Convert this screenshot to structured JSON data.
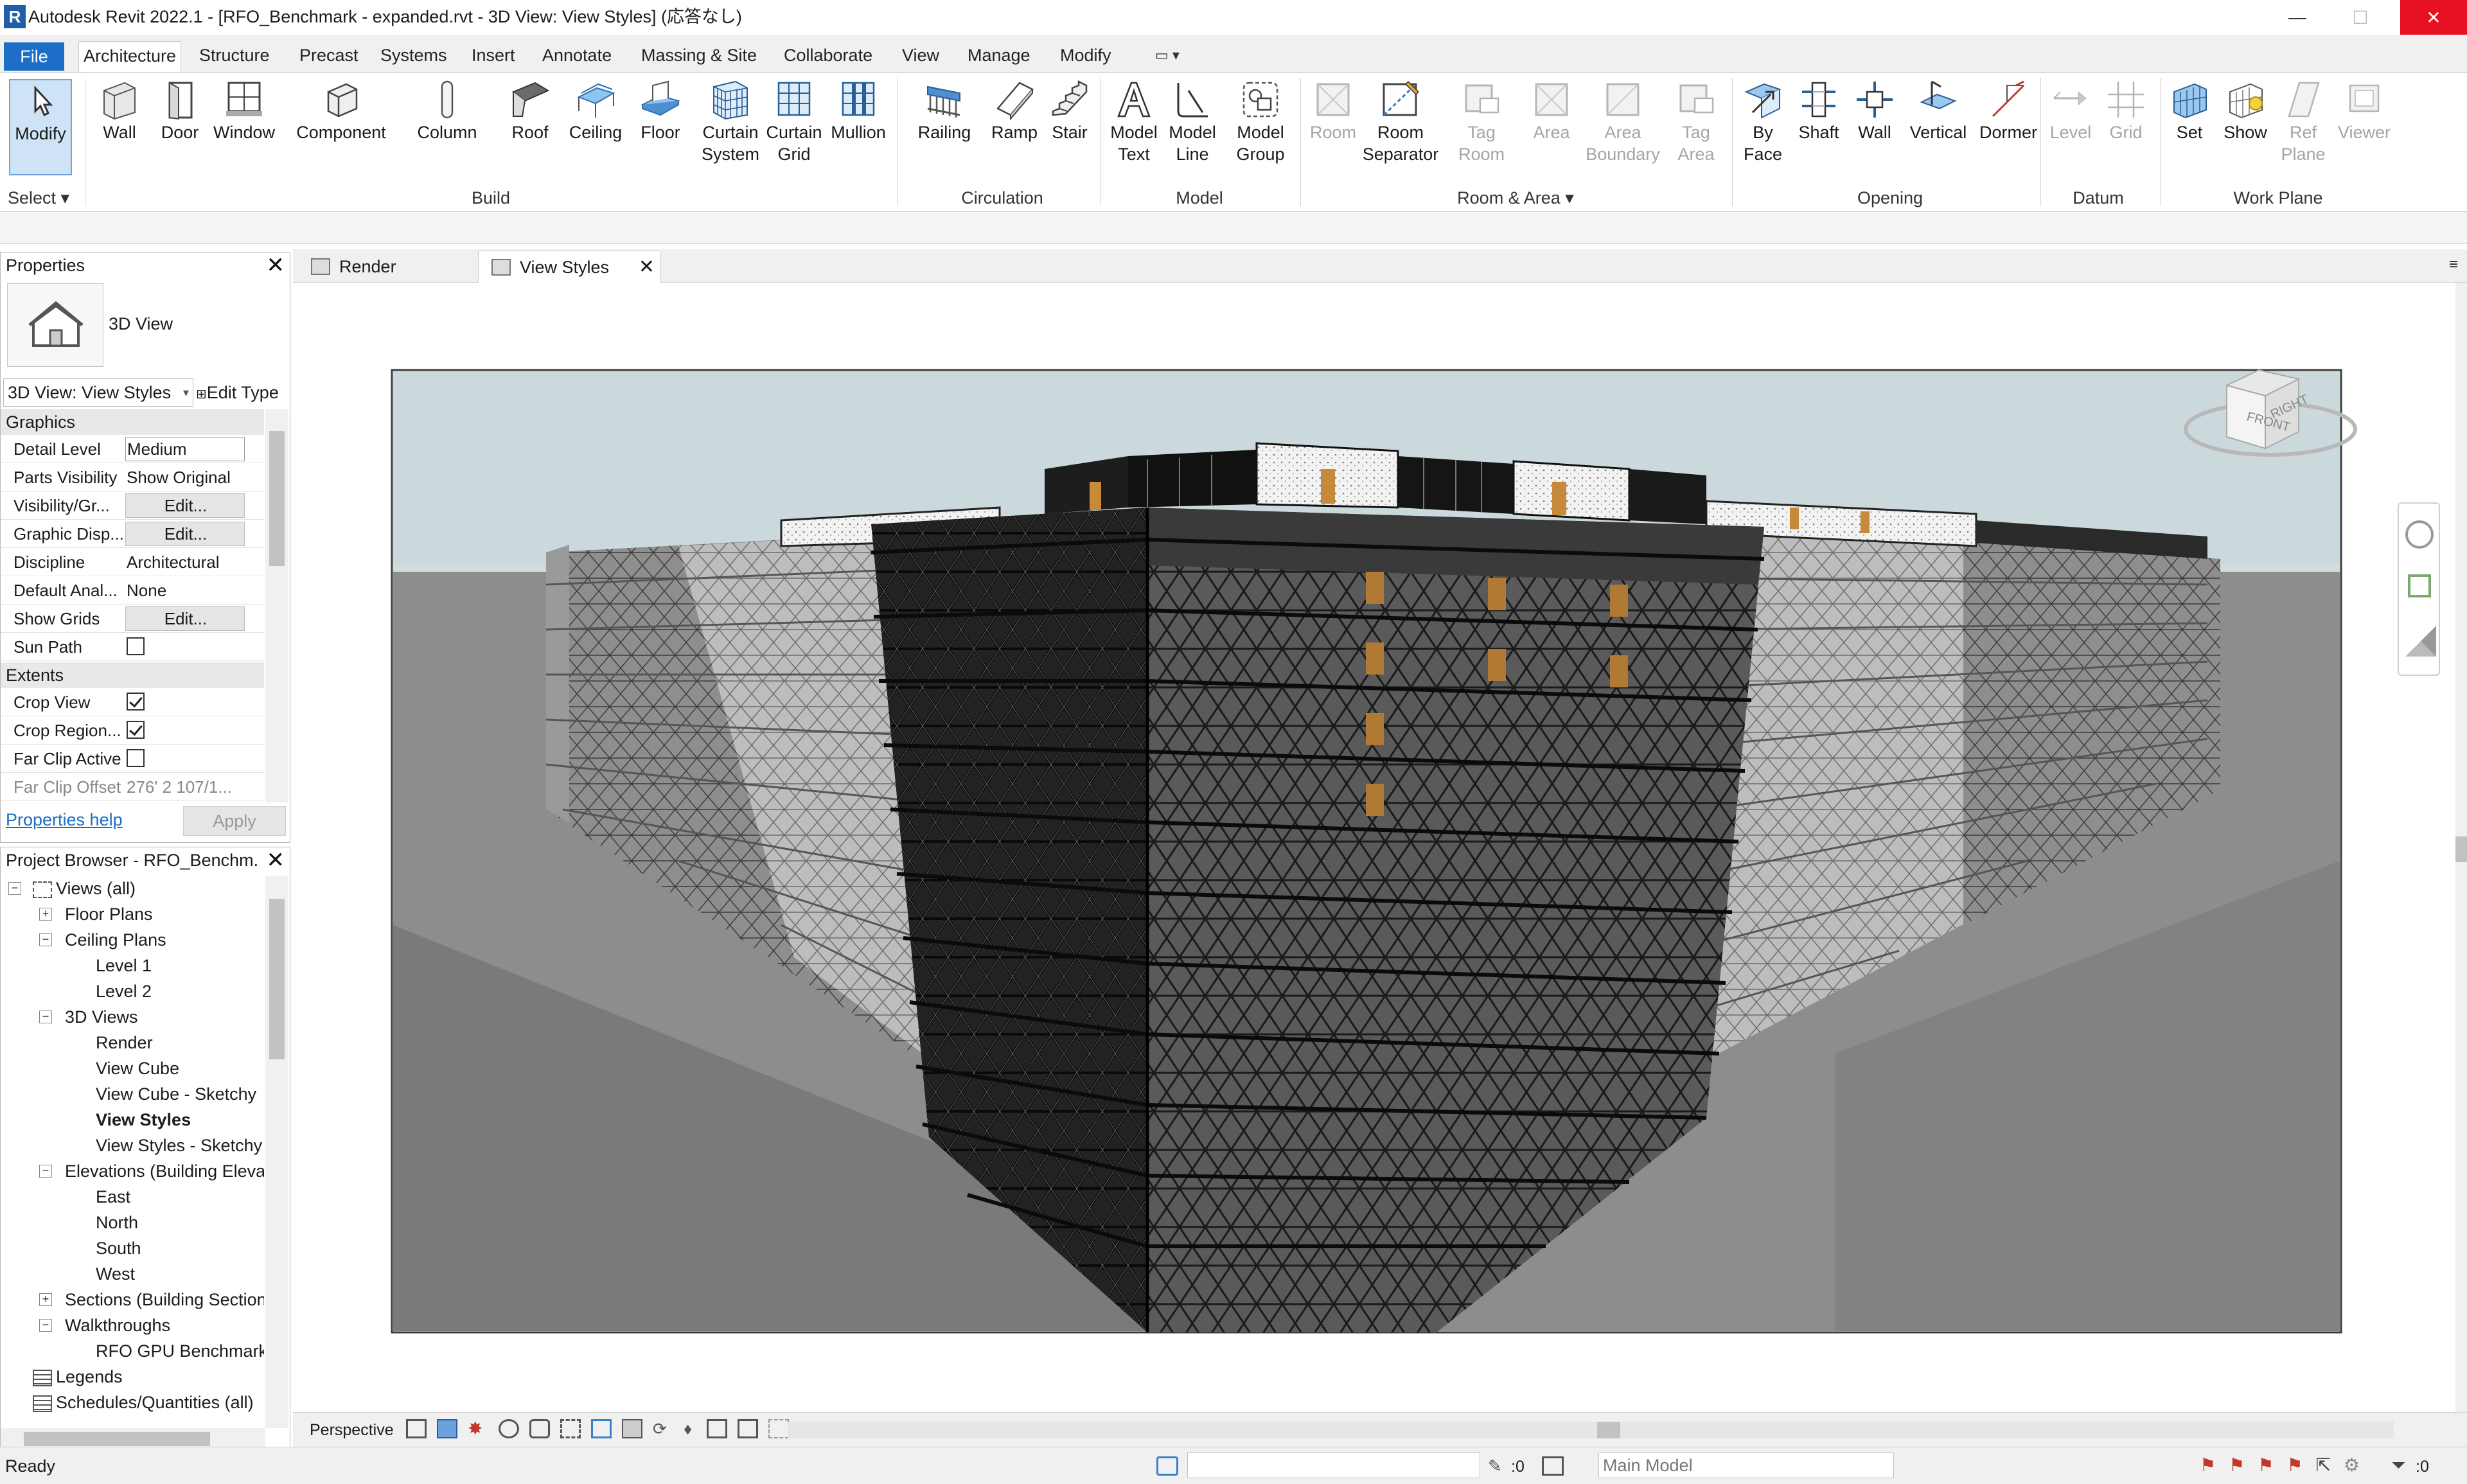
{
  "window": {
    "title": "Autodesk Revit 2022.1 - [RFO_Benchmark - expanded.rvt - 3D View: View Styles] (応答なし)",
    "app_icon_letter": "R",
    "minimize": "—",
    "maximize": "☐",
    "close": "✕"
  },
  "menu": {
    "tabs": [
      "File",
      "Architecture",
      "Structure",
      "Precast",
      "Systems",
      "Insert",
      "Annotate",
      "Massing & Site",
      "Collaborate",
      "View",
      "Manage",
      "Modify"
    ],
    "active": "Architecture",
    "quick_access": "▭ ▾"
  },
  "ribbon": {
    "groups": [
      {
        "label": "Select ▾",
        "buttons": [
          {
            "label": "Modify",
            "icon": "cursor-icon",
            "enabled": true
          }
        ]
      },
      {
        "label": "Build",
        "buttons": [
          {
            "label": "Wall",
            "icon": "wall-icon",
            "enabled": true,
            "dropdown": true
          },
          {
            "label": "Door",
            "icon": "door-icon",
            "enabled": true
          },
          {
            "label": "Window",
            "icon": "window-icon",
            "enabled": true
          },
          {
            "label": "Component",
            "icon": "component-icon",
            "enabled": true,
            "dropdown": true
          },
          {
            "label": "Column",
            "icon": "column-icon",
            "enabled": true,
            "dropdown": true
          },
          {
            "label": "Roof",
            "icon": "roof-icon",
            "enabled": true,
            "dropdown": true
          },
          {
            "label": "Ceiling",
            "icon": "ceiling-icon",
            "enabled": true
          },
          {
            "label": "Floor",
            "icon": "floor-icon",
            "enabled": true,
            "dropdown": true
          },
          {
            "label": "Curtain\nSystem",
            "icon": "curtain-system-icon",
            "enabled": true
          },
          {
            "label": "Curtain\nGrid",
            "icon": "curtain-grid-icon",
            "enabled": true
          },
          {
            "label": "Mullion",
            "icon": "mullion-icon",
            "enabled": true
          }
        ]
      },
      {
        "label": "Circulation",
        "buttons": [
          {
            "label": "Railing",
            "icon": "railing-icon",
            "enabled": true,
            "dropdown": true
          },
          {
            "label": "Ramp",
            "icon": "ramp-icon",
            "enabled": true
          },
          {
            "label": "Stair",
            "icon": "stair-icon",
            "enabled": true
          }
        ]
      },
      {
        "label": "Model",
        "buttons": [
          {
            "label": "Model\nText",
            "icon": "model-text-icon",
            "enabled": true
          },
          {
            "label": "Model\nLine",
            "icon": "model-line-icon",
            "enabled": true
          },
          {
            "label": "Model\nGroup",
            "icon": "model-group-icon",
            "enabled": true,
            "dropdown": true
          }
        ]
      },
      {
        "label": "Room & Area ▾",
        "buttons": [
          {
            "label": "Room",
            "icon": "room-icon",
            "enabled": false
          },
          {
            "label": "Room\nSeparator",
            "icon": "room-separator-icon",
            "enabled": true
          },
          {
            "label": "Tag\nRoom",
            "icon": "tag-room-icon",
            "enabled": false,
            "dropdown": true
          },
          {
            "label": "Area",
            "icon": "area-icon",
            "enabled": false,
            "dropdown": true
          },
          {
            "label": "Area\nBoundary",
            "icon": "area-boundary-icon",
            "enabled": false
          },
          {
            "label": "Tag\nArea",
            "icon": "tag-area-icon",
            "enabled": false,
            "dropdown": true
          }
        ]
      },
      {
        "label": "Opening",
        "buttons": [
          {
            "label": "By\nFace",
            "icon": "by-face-icon",
            "enabled": true
          },
          {
            "label": "Shaft",
            "icon": "shaft-icon",
            "enabled": true
          },
          {
            "label": "Wall",
            "icon": "wall-opening-icon",
            "enabled": true
          },
          {
            "label": "Vertical",
            "icon": "vertical-opening-icon",
            "enabled": true
          },
          {
            "label": "Dormer",
            "icon": "dormer-icon",
            "enabled": true
          }
        ]
      },
      {
        "label": "Datum",
        "buttons": [
          {
            "label": "Level",
            "icon": "level-icon",
            "enabled": false
          },
          {
            "label": "Grid",
            "icon": "grid-icon",
            "enabled": false
          }
        ]
      },
      {
        "label": "Work Plane",
        "buttons": [
          {
            "label": "Set",
            "icon": "set-workplane-icon",
            "enabled": true
          },
          {
            "label": "Show",
            "icon": "show-workplane-icon",
            "enabled": true
          },
          {
            "label": "Ref\nPlane",
            "icon": "ref-plane-icon",
            "enabled": false
          },
          {
            "label": "Viewer",
            "icon": "viewer-icon",
            "enabled": false
          }
        ]
      }
    ]
  },
  "properties": {
    "title": "Properties",
    "type_name": "3D View",
    "instance_selector": "3D View: View Styles",
    "edit_type": "Edit Type",
    "category_graphics": "Graphics",
    "category_extents": "Extents",
    "rows": [
      {
        "key": "Detail Level",
        "value": "Medium",
        "kind": "box"
      },
      {
        "key": "Parts Visibility",
        "value": "Show Original",
        "kind": "text"
      },
      {
        "key": "Visibility/Gr...",
        "value": "Edit...",
        "kind": "btn"
      },
      {
        "key": "Graphic Disp...",
        "value": "Edit...",
        "kind": "btn"
      },
      {
        "key": "Discipline",
        "value": "Architectural",
        "kind": "text"
      },
      {
        "key": "Default Anal...",
        "value": "None",
        "kind": "text"
      },
      {
        "key": "Show Grids",
        "value": "Edit...",
        "kind": "btn"
      },
      {
        "key": "Sun Path",
        "value": "",
        "kind": "check",
        "checked": false
      }
    ],
    "extents_rows": [
      {
        "key": "Crop View",
        "checked": true
      },
      {
        "key": "Crop Region...",
        "checked": true
      },
      {
        "key": "Far Clip Active",
        "checked": false
      }
    ],
    "far_clip_offset_key": "Far Clip Offset",
    "far_clip_offset_value": "276'  2 107/1...",
    "help_link": "Properties help",
    "apply": "Apply"
  },
  "browser": {
    "title": "Project Browser - RFO_Benchm...",
    "items": [
      {
        "label": "Views (all)",
        "level": 0,
        "toggle": "−",
        "icon": true
      },
      {
        "label": "Floor Plans",
        "level": 1,
        "toggle": "+"
      },
      {
        "label": "Ceiling Plans",
        "level": 1,
        "toggle": "−"
      },
      {
        "label": "Level 1",
        "level": 2
      },
      {
        "label": "Level 2",
        "level": 2
      },
      {
        "label": "3D Views",
        "level": 1,
        "toggle": "−"
      },
      {
        "label": "Render",
        "level": 2
      },
      {
        "label": "View Cube",
        "level": 2
      },
      {
        "label": "View Cube - Sketchy",
        "level": 2
      },
      {
        "label": "View Styles",
        "level": 2,
        "bold": true
      },
      {
        "label": "View Styles - Sketchy",
        "level": 2
      },
      {
        "label": "Elevations (Building Eleva",
        "level": 1,
        "toggle": "−"
      },
      {
        "label": "East",
        "level": 2
      },
      {
        "label": "North",
        "level": 2
      },
      {
        "label": "South",
        "level": 2
      },
      {
        "label": "West",
        "level": 2
      },
      {
        "label": "Sections (Building Section",
        "level": 1,
        "toggle": "+"
      },
      {
        "label": "Walkthroughs",
        "level": 1,
        "toggle": "−"
      },
      {
        "label": "RFO GPU Benchmark",
        "level": 2
      },
      {
        "label": "Legends",
        "level": 0,
        "icon": true
      },
      {
        "label": "Schedules/Quantities (all)",
        "level": 0,
        "icon": true
      }
    ]
  },
  "view_tabs": [
    {
      "label": "Render",
      "active": false
    },
    {
      "label": "View Styles",
      "active": true
    }
  ],
  "viewcube": {
    "front": "FRONT",
    "right": "RIGHT"
  },
  "view_control_bar": {
    "projection": "Perspective"
  },
  "status": {
    "text": "Ready",
    "selection_count": ":0",
    "active_model": "Main Model",
    "filter_count": ":0"
  },
  "colors": {
    "accent": "#1d6ec7",
    "sky": "#c9d6d9",
    "ground": "#8a8a8a",
    "facade_dark": "#141414",
    "wood": "#c78a3a"
  }
}
